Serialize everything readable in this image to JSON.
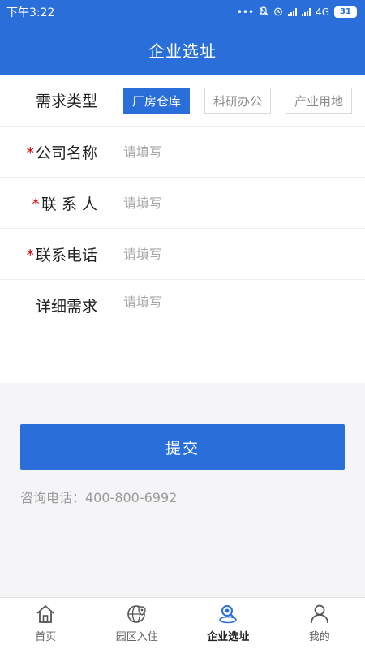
{
  "status": {
    "time": "下午3:22",
    "network": "4G",
    "battery": "31"
  },
  "header": {
    "title": "企业选址"
  },
  "form": {
    "type_label": "需求类型",
    "types": [
      {
        "label": "厂房仓库",
        "active": true
      },
      {
        "label": "科研办公",
        "active": false
      },
      {
        "label": "产业用地",
        "active": false
      }
    ],
    "company": {
      "label": "公司名称",
      "placeholder": "请填写",
      "value": ""
    },
    "contact": {
      "label": "联 系 人",
      "placeholder": "请填写",
      "value": ""
    },
    "phone": {
      "label": "联系电话",
      "placeholder": "请填写",
      "value": ""
    },
    "detail": {
      "label": "详细需求",
      "placeholder": "请填写",
      "value": ""
    },
    "required_mark": "*"
  },
  "submit_label": "提交",
  "consult_text": "咨询电话：400-800-6992",
  "tabbar": {
    "items": [
      {
        "label": "首页",
        "icon": "home-icon"
      },
      {
        "label": "园区入住",
        "icon": "globe-pin-icon"
      },
      {
        "label": "企业选址",
        "icon": "location-search-icon",
        "active": true
      },
      {
        "label": "我的",
        "icon": "user-icon"
      }
    ]
  },
  "colors": {
    "primary": "#2a6fd9",
    "required": "#cc0000"
  }
}
